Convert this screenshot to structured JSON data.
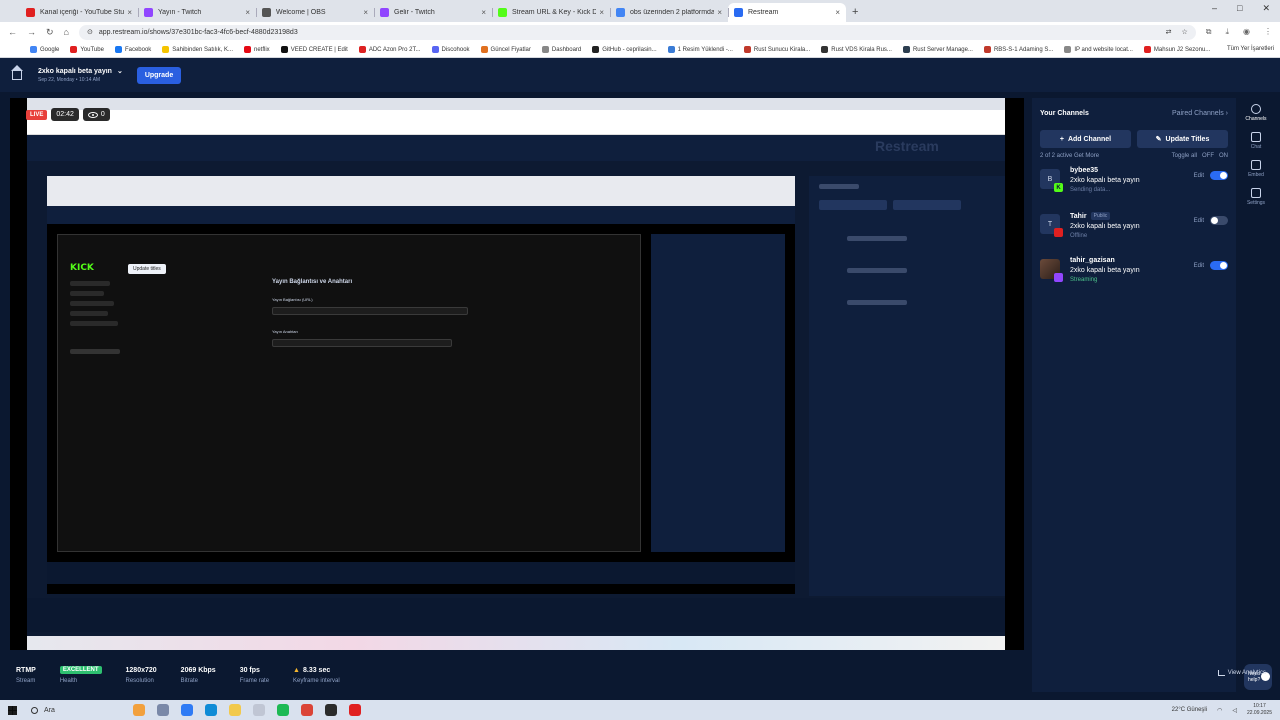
{
  "browser": {
    "tabs": [
      {
        "label": "Kanal içeriği - YouTube Studio",
        "color": "#e02020"
      },
      {
        "label": "Yayın - Twitch",
        "color": "#9146ff"
      },
      {
        "label": "Welcome | OBS",
        "color": "#555555"
      },
      {
        "label": "Gelir - Twitch",
        "color": "#9146ff"
      },
      {
        "label": "Stream URL & Key - Kick Dash",
        "color": "#53fc18"
      },
      {
        "label": "obs üzerinden 2 platformda y...",
        "color": "#4285f4"
      },
      {
        "label": "Restream",
        "color": "#2a6bf2"
      }
    ],
    "new_tab": "+",
    "window_controls": [
      "–",
      "□",
      "✕"
    ],
    "url": "app.restream.io/shows/37e301bc-fac3-4fc6-becf-4880d23198d3",
    "bookmarks": [
      {
        "label": "Google",
        "color": "#4285f4"
      },
      {
        "label": "YouTube",
        "color": "#e02020"
      },
      {
        "label": "Facebook",
        "color": "#1877f2"
      },
      {
        "label": "Sahibinden Satılık, K...",
        "color": "#f5c400"
      },
      {
        "label": "netflix",
        "color": "#e50914"
      },
      {
        "label": "VEED CREATE | Edit",
        "color": "#111111"
      },
      {
        "label": "ADC Azon Pro 2T...",
        "color": "#d22"
      },
      {
        "label": "Discohook",
        "color": "#5865f2"
      },
      {
        "label": "Güncel Fiyatlar",
        "color": "#e07020"
      },
      {
        "label": "Dashboard",
        "color": "#888888"
      },
      {
        "label": "GitHub - ceprilasin...",
        "color": "#222222"
      },
      {
        "label": "1 Resim Yüklendi -...",
        "color": "#3a7bd5"
      },
      {
        "label": "Rust Sunucu Kirala...",
        "color": "#c0392b"
      },
      {
        "label": "Rust VDS Kirala Rus...",
        "color": "#333333"
      },
      {
        "label": "Rust Server Manage...",
        "color": "#2c3e50"
      },
      {
        "label": "RBS-S-1 Adaming S...",
        "color": "#c0392b"
      },
      {
        "label": "IP and website locat...",
        "color": "#888888"
      },
      {
        "label": "Mahsun J2 Sezonu...",
        "color": "#e02020"
      }
    ],
    "all_bookmarks": "Tüm Yer İşaretleri"
  },
  "header": {
    "event_title": "2xko kapalı beta yayın",
    "event_date": "Sep 22, Monday • 10:14 AM",
    "upgrade": "Upgrade"
  },
  "preview": {
    "live": "LIVE",
    "timer": "02:42",
    "viewers": "0",
    "tooltip": "Update titles",
    "inner_title": "Yayın Bağlantısı ve Anahtarı",
    "kick_logo": "KICK",
    "inner_url_label": "Yayın Bağlantısı (URL)",
    "inner_key_label": "Yayın Anahtarı",
    "inner_watermark": "Restream"
  },
  "sidebar": {
    "title": "Your Channels",
    "paired": "Paired Channels",
    "add_channel": "Add Channel",
    "update_titles": "Update Titles",
    "active_count": "2 of 2 active  Get More",
    "toggle_all": "Toggle all",
    "off": "OFF",
    "on": "ON",
    "channels": [
      {
        "name": "bybee35",
        "badge": "",
        "title": "2xko kapalı beta yayın",
        "status": "Sending data...",
        "edit": "Edit",
        "initial": "B",
        "platform": "K",
        "platform_color": "#53fc18",
        "enabled": true
      },
      {
        "name": "Tahir",
        "badge": "Public",
        "title": "2xko kapalı beta yayın",
        "status": "Offline",
        "edit": "Edit",
        "initial": "T",
        "platform": "",
        "platform_color": "#e02020",
        "enabled": false
      },
      {
        "name": "tahir_gazisan",
        "badge": "",
        "title": "2xko kapalı beta yayın",
        "status": "Streaming",
        "edit": "Edit",
        "initial": "",
        "platform": "",
        "platform_color": "#9146ff",
        "enabled": true
      }
    ]
  },
  "rail": [
    {
      "label": "Channels",
      "active": true
    },
    {
      "label": "Chat",
      "active": false
    },
    {
      "label": "Embed",
      "active": false
    },
    {
      "label": "Settings",
      "active": false
    }
  ],
  "help": "Need help?",
  "stats": {
    "items": [
      {
        "value": "RTMP",
        "label": "Stream"
      },
      {
        "value": "EXCELLENT",
        "label": "Health"
      },
      {
        "value": "1280x720",
        "label": "Resolution"
      },
      {
        "value": "2069 Kbps",
        "label": "Bitrate"
      },
      {
        "value": "30 fps",
        "label": "Frame rate"
      },
      {
        "value": "8.33 sec",
        "label": "Keyframe interval"
      }
    ],
    "warning_icon": "▲",
    "analytics": "View Analytics"
  },
  "taskbar": {
    "search": "Ara",
    "apps": [
      "#f2a03d",
      "#7a88a8",
      "#2f7bf5",
      "#0f8bd6",
      "#f2c94c",
      "#c0c6d4",
      "#1db954",
      "#db4437",
      "#2b2b2b",
      "#e02020"
    ],
    "weather": "22°C  Güneşli",
    "time": "10:17",
    "date": "22.09.2025"
  }
}
